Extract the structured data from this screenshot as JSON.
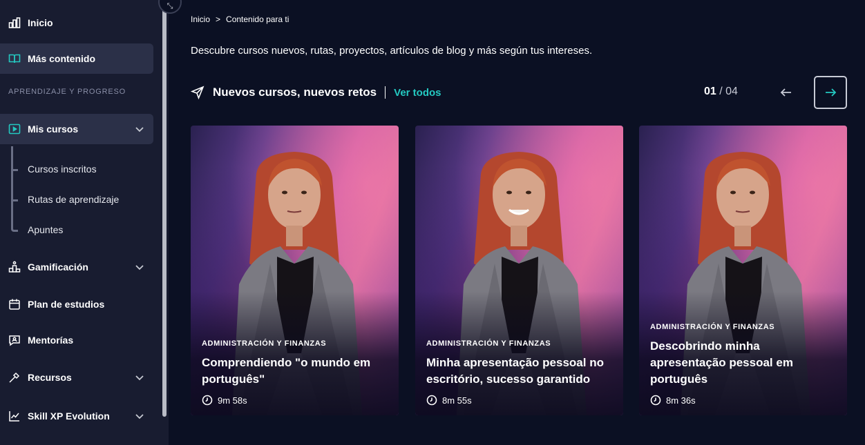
{
  "sidebar": {
    "collapse_icon": "collapse-arrows-icon",
    "items_top": [
      {
        "label": "Inicio",
        "icon": "bar-chart-icon"
      },
      {
        "label": "Más contenido",
        "icon": "open-book-icon",
        "active": true
      }
    ],
    "section_label": "APRENDIZAJE Y PROGRESO",
    "mis_cursos": {
      "label": "Mis cursos",
      "icon": "play-square-icon"
    },
    "sub_items": [
      "Cursos inscritos",
      "Rutas de aprendizaje",
      "Apuntes"
    ],
    "items_bottom": [
      {
        "label": "Gamificación",
        "icon": "podium-icon",
        "expandable": true
      },
      {
        "label": "Plan de estudios",
        "icon": "calendar-icon",
        "expandable": false
      },
      {
        "label": "Mentorías",
        "icon": "chat-person-icon",
        "expandable": false
      },
      {
        "label": "Recursos",
        "icon": "tools-icon",
        "expandable": true
      },
      {
        "label": "Skill XP Evolution",
        "icon": "trend-chart-icon",
        "expandable": true
      }
    ]
  },
  "breadcrumb": {
    "home": "Inicio",
    "sep": ">",
    "current": "Contenido para ti"
  },
  "intro": "Descubre cursos nuevos, rutas, proyectos, artículos de blog y más según tus intereses.",
  "section": {
    "title": "Nuevos cursos, nuevos retos",
    "link": "Ver todos",
    "page_current": "01",
    "page_sep": " / ",
    "page_total": "04"
  },
  "colors": {
    "accent": "#24c9c1",
    "background": "#0b1023",
    "sidebar": "#181c30"
  },
  "cards": [
    {
      "category": "ADMINISTRACIÓN Y FINANZAS",
      "title": "Comprendiendo \"o mundo em português\"",
      "duration": "9m 58s",
      "smile": false
    },
    {
      "category": "ADMINISTRACIÓN Y FINANZAS",
      "title": "Minha apresentação pessoal no escritório, sucesso garantido",
      "duration": "8m 55s",
      "smile": true
    },
    {
      "category": "ADMINISTRACIÓN Y FINANZAS",
      "title": "Descobrindo minha apresentação pessoal em português",
      "duration": "8m 36s",
      "smile": false
    }
  ]
}
